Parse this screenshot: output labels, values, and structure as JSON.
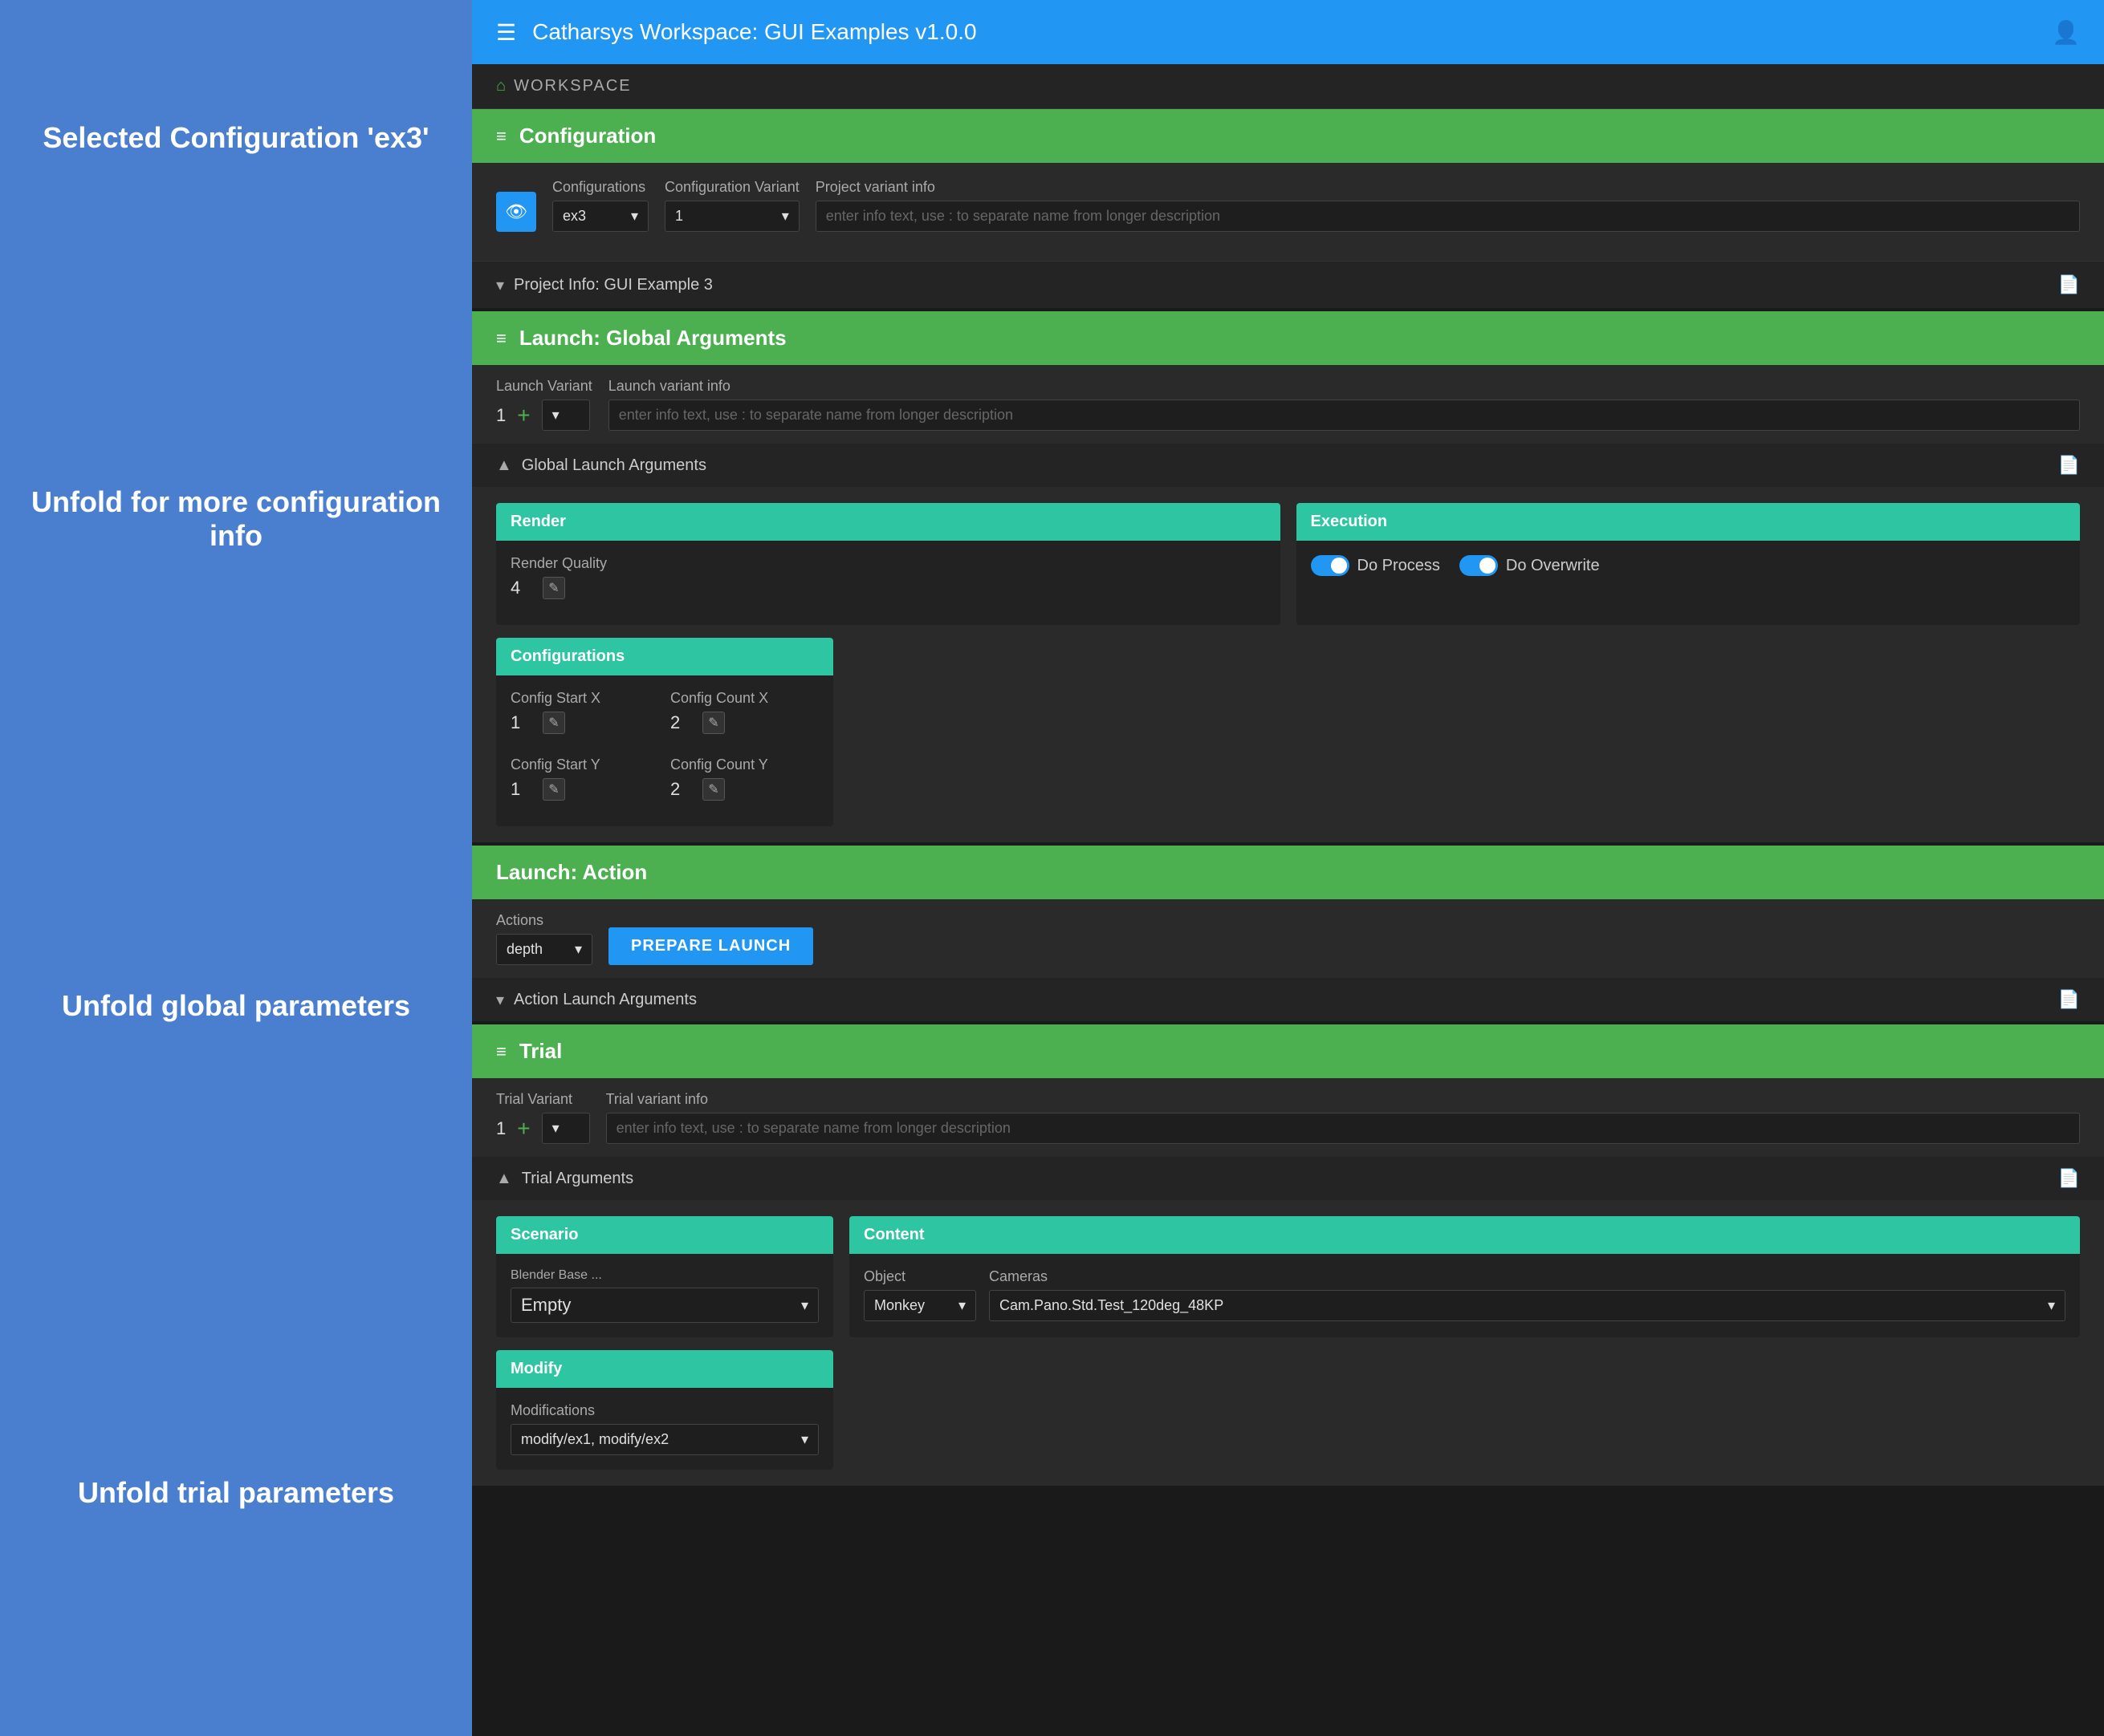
{
  "app": {
    "title": "Catharsys Workspace: GUI Examples v1.0.0",
    "breadcrumb": "WORKSPACE"
  },
  "annotations": {
    "selected_config": "Selected Configuration 'ex3'",
    "unfold_config": "Unfold for more configuration info",
    "unfold_global": "Unfold global parameters",
    "unfold_trial": "Unfold trial parameters"
  },
  "configuration": {
    "header": "Configuration",
    "configurations_label": "Configurations",
    "configurations_value": "ex3",
    "variant_label": "Configuration Variant",
    "variant_value": "1",
    "project_variant_label": "Project variant info",
    "project_variant_placeholder": "enter info text, use : to separate name from longer description",
    "project_info": "Project Info: GUI Example 3"
  },
  "launch_global": {
    "header": "Launch: Global Arguments",
    "variant_label": "Launch Variant",
    "variant_value": "1",
    "info_label": "Launch variant info",
    "info_placeholder": "enter info text, use : to separate name from longer description",
    "args_title": "Global Launch Arguments",
    "render_card": {
      "title": "Render",
      "quality_label": "Render Quality",
      "quality_value": "4"
    },
    "execution_card": {
      "title": "Execution",
      "do_process_label": "Do Process",
      "do_overwrite_label": "Do Overwrite"
    },
    "configurations_card": {
      "title": "Configurations",
      "config_start_x_label": "Config Start X",
      "config_start_x_value": "1",
      "config_count_x_label": "Config Count X",
      "config_count_x_value": "2",
      "config_start_y_label": "Config Start Y",
      "config_start_y_value": "1",
      "config_count_y_label": "Config Count Y",
      "config_count_y_value": "2"
    }
  },
  "launch_action": {
    "header": "Launch: Action",
    "actions_label": "Actions",
    "actions_value": "depth",
    "prepare_btn": "PREPARE LAUNCH",
    "args_title": "Action Launch Arguments"
  },
  "trial": {
    "header": "Trial",
    "variant_label": "Trial Variant",
    "variant_value": "1",
    "info_label": "Trial variant info",
    "info_placeholder": "enter info text, use : to separate name from longer description",
    "args_title": "Trial Arguments",
    "scenario_card": {
      "title": "Scenario",
      "blender_label": "Blender Base ...",
      "blender_value": "Empty"
    },
    "content_card": {
      "title": "Content",
      "object_label": "Object",
      "object_value": "Monkey",
      "cameras_label": "Cameras",
      "cameras_value": "Cam.Pano.Std.Test_120deg_48KP"
    },
    "modify_card": {
      "title": "Modify",
      "modifications_label": "Modifications",
      "modifications_value": "modify/ex1, modify/ex2"
    }
  }
}
